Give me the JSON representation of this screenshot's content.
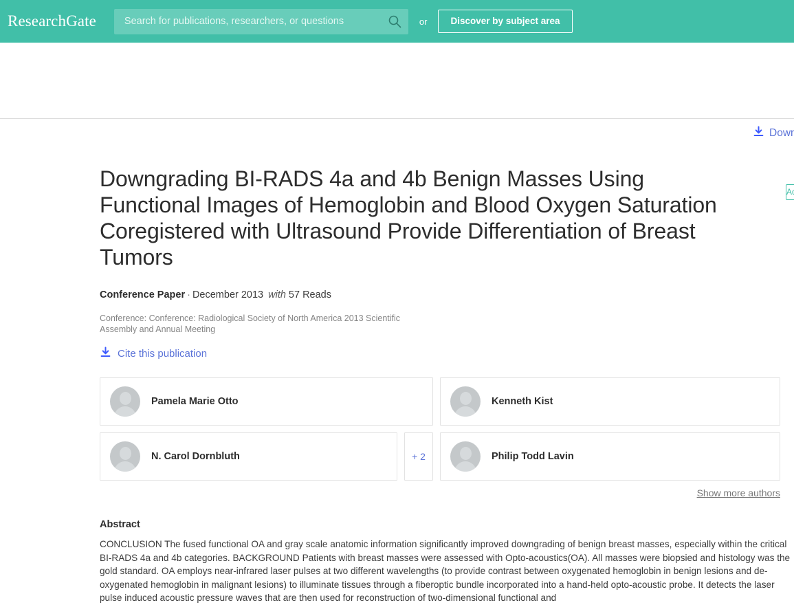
{
  "header": {
    "logo_text": "ResearchGate",
    "search": {
      "placeholder": "Search for publications, researchers, or questions",
      "value": "",
      "icon": "search-icon"
    },
    "or_label": "or",
    "discover_button": "Discover by subject area",
    "brand_color": "#41bfa8",
    "search_field_color": "#68cdba"
  },
  "actions": {
    "download_label": "Download",
    "download_icon": "download-icon",
    "add_chip_label": "Add",
    "link_color": "#5b73d8",
    "chip_border_color": "#41bfa8"
  },
  "publication": {
    "title": "Downgrading BI-RADS 4a and 4b Benign Masses Using Functional Images of Hemoglobin and Blood Oxygen Saturation Coregistered with Ultrasound Provide Differentiation of Breast Tumors",
    "type": "Conference Paper",
    "separator": "·",
    "date": "December 2013",
    "with_label": "with",
    "reads": "57 Reads",
    "conference": "Conference: Conference: Radiological Society of North America 2013 Scientific Assembly and Annual Meeting",
    "cite_label": "Cite this publication",
    "cite_icon": "download-icon"
  },
  "authors": {
    "list": [
      {
        "name": "Pamela Marie Otto",
        "avatar": "person-avatar"
      },
      {
        "name": "Kenneth Kist",
        "avatar": "person-avatar"
      },
      {
        "name": "N. Carol Dornbluth",
        "avatar": "person-avatar"
      },
      {
        "name": "Philip Todd Lavin",
        "avatar": "person-avatar"
      }
    ],
    "more_count_label": "+ 2",
    "show_more_label": "Show more authors"
  },
  "abstract": {
    "heading": "Abstract",
    "text": "CONCLUSION The fused functional OA and gray scale anatomic information significantly improved downgrading of benign breast masses, especially within the critical BI-RADS 4a and 4b categories. BACKGROUND Patients with breast masses were assessed with Opto-acoustics(OA). All masses were biopsied and histology was the gold standard. OA employs near-infrared laser pulses at two different wavelengths (to provide contrast between oxygenated hemoglobin in benign lesions and de-oxygenated hemoglobin in malignant lesions) to illuminate tissues through a fiberoptic bundle incorporated into a hand-held opto-acoustic probe. It detects the laser pulse induced acoustic pressure waves that are then used for reconstruction of two-dimensional functional and"
  }
}
